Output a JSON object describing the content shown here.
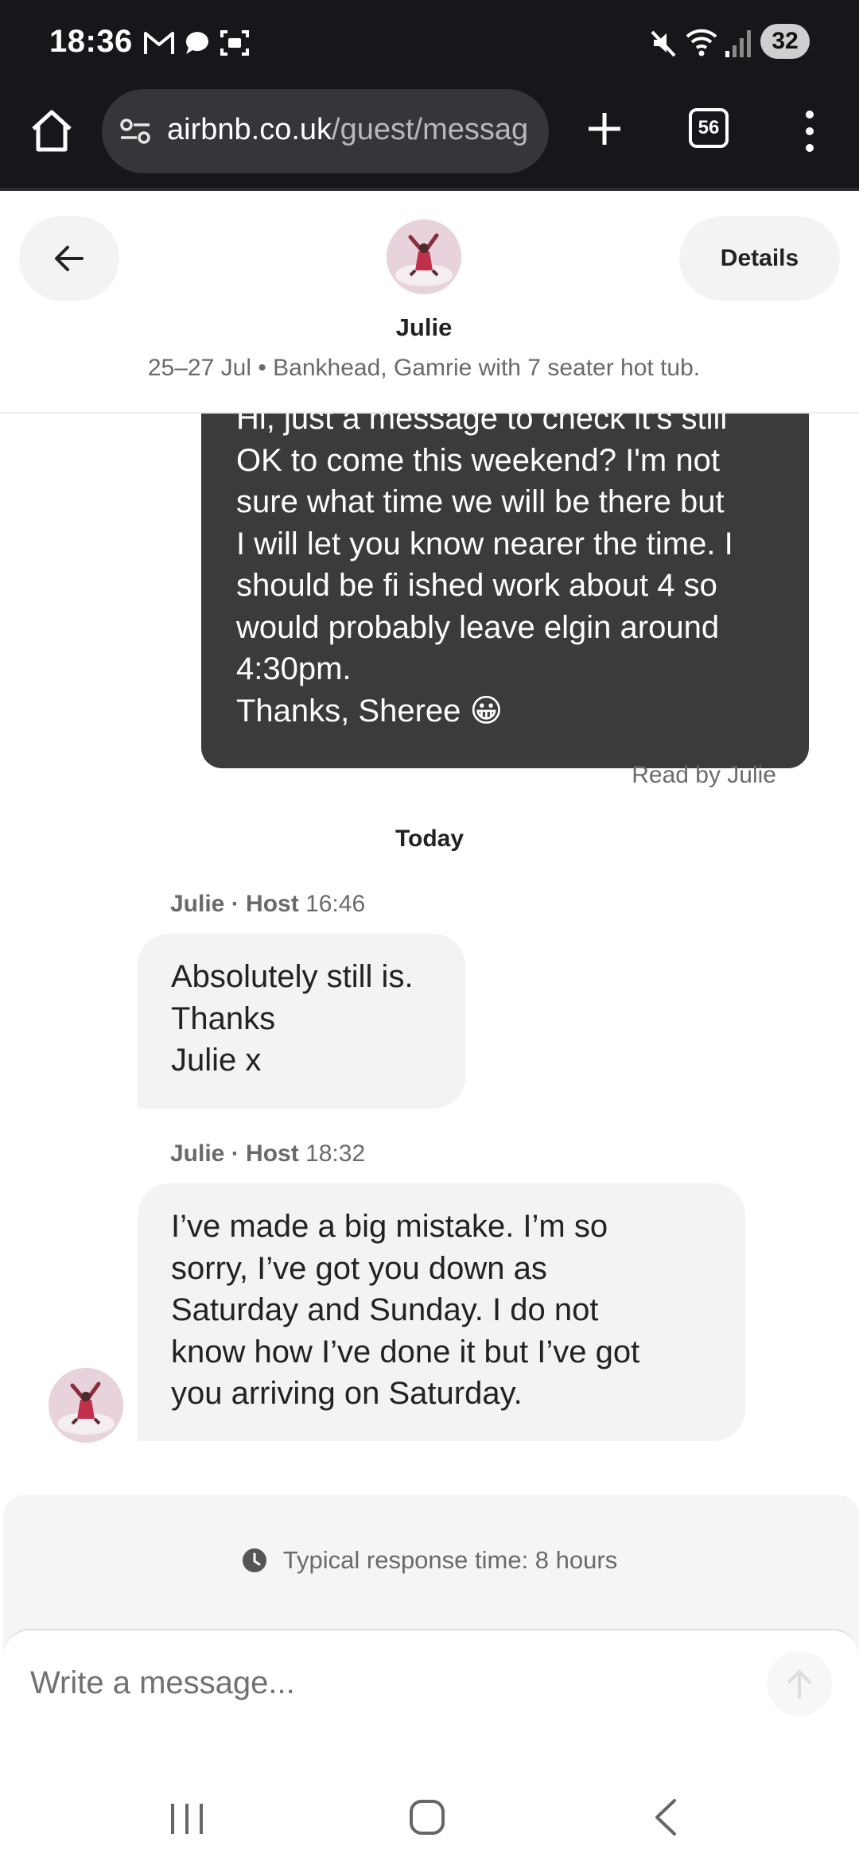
{
  "status_bar": {
    "time": "18:36",
    "battery": "32",
    "notification_icons": [
      "gmail-icon",
      "chat-icon",
      "screenshot-icon"
    ],
    "system_icons": [
      "mute-icon",
      "wifi-icon",
      "signal-icon"
    ]
  },
  "browser": {
    "url_host": "airbnb.co.uk",
    "url_path": "/guest/messag",
    "tab_count": "56"
  },
  "header": {
    "host_name": "Julie",
    "trip_info": "25–27 Jul • Bankhead, Gamrie with 7 seater hot tub.",
    "details_label": "Details"
  },
  "messages": {
    "guest_message_lines": [
      "Hi, just a message to check it’s still",
      "OK to come this weekend? I'm not",
      "sure what time we will be there but",
      "I will let you know nearer the time. I",
      "should be fi ished work about 4 so",
      "would probably leave elgin around",
      "4:30pm.",
      "Thanks, Sheree 😀"
    ],
    "read_receipt": "Read by Julie",
    "day_separator": "Today",
    "host_messages": [
      {
        "sender": "Julie",
        "role": "· Host",
        "time": "16:46",
        "lines": [
          "Absolutely still is.",
          "Thanks",
          "Julie x"
        ]
      },
      {
        "sender": "Julie",
        "role": "· Host",
        "time": "18:32",
        "lines": [
          "I’ve made a big mistake. I’m so",
          "sorry, I’ve got you down as",
          "Saturday and Sunday. I do not",
          "know how I’ve done it but I’ve got",
          "you arriving on Saturday."
        ]
      }
    ]
  },
  "composer": {
    "response_time": "Typical response time: 8 hours",
    "placeholder": "Write a message..."
  },
  "colors": {
    "guest_bubble": "#3b3b3b",
    "host_bubble": "#f3f3f3",
    "chrome_bg": "#16171b",
    "avatar_bg": "#e2c7d2"
  }
}
